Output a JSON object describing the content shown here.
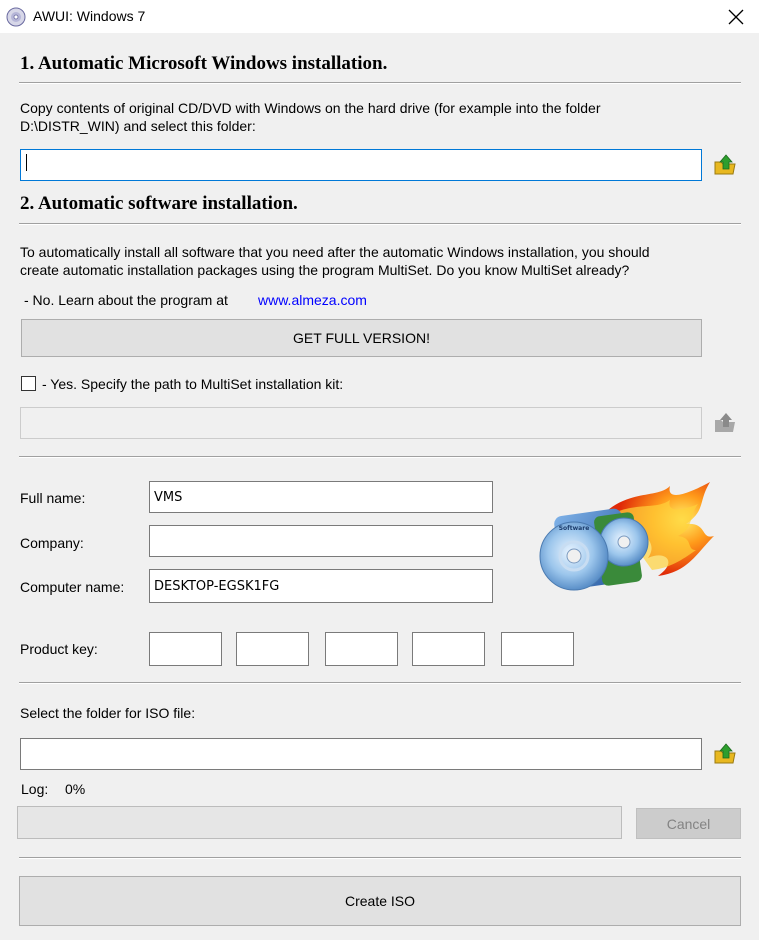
{
  "window": {
    "title": "AWUI: Windows 7"
  },
  "section1": {
    "title": "1. Automatic Microsoft Windows installation.",
    "description_line1": "Copy contents of original CD/DVD with Windows on the hard drive (for example into the folder",
    "description_line2": "D:\\DISTR_WIN) and select this folder:",
    "folder_value": ""
  },
  "section2": {
    "title": "2. Automatic software installation.",
    "description_line1": "To automatically install all software that you need after the automatic Windows installation, you should",
    "description_line2": "create automatic installation packages using the program MultiSet. Do you know MultiSet already?",
    "no_text": "- No. Learn about the program at",
    "link_text": "www.almeza.com",
    "full_version_label": "GET FULL VERSION!",
    "yes_text": "- Yes. Specify the path to MultiSet installation kit:",
    "yes_checked": false,
    "kit_path_value": ""
  },
  "user": {
    "full_name_label": "Full name:",
    "full_name_value": "VMS",
    "company_label": "Company:",
    "company_value": "",
    "computer_name_label": "Computer name:",
    "computer_name_value": "DESKTOP-EGSK1FG",
    "product_key_label": "Product key:",
    "product_key": [
      "",
      "",
      "",
      "",
      ""
    ],
    "logo_label": "Software"
  },
  "iso": {
    "select_label": "Select the folder for ISO file:",
    "folder_value": "",
    "log_label": "Log:",
    "progress_text": "0%",
    "progress": 0,
    "cancel_label": "Cancel",
    "create_label": "Create ISO"
  },
  "colors": {
    "focus_border": "#0078d7",
    "link": "#0000ff",
    "arrow_green": "#2e9e2e",
    "folder_yellow": "#e8b820"
  },
  "icons": [
    "cd-icon",
    "close-icon",
    "browse-folder-icon",
    "software-disc-logo"
  ]
}
